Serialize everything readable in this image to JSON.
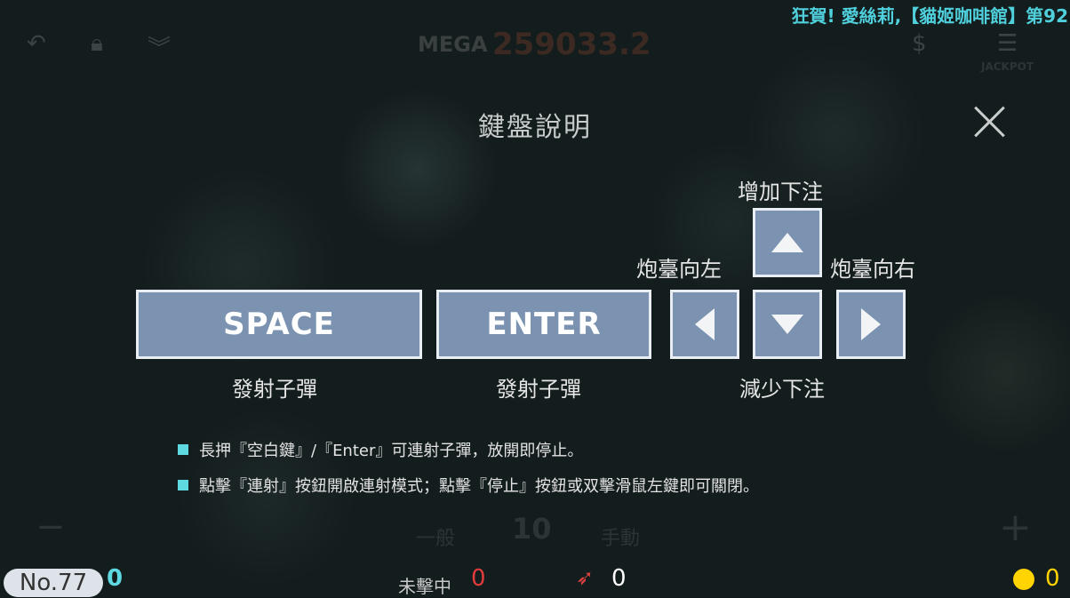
{
  "marquee": "狂賀! 愛絲莉,【貓姬咖啡館】第92",
  "hud": {
    "mega_label": "MEGA",
    "mega_value": "259033.2",
    "jackpot_label": "JACKPOT",
    "player_no": "No.77",
    "player_score": "0",
    "miss_label": "未擊中",
    "miss_count": "0",
    "rocket_count": "0",
    "coin_count": "0",
    "bet_value": "10",
    "mode_normal": "一般",
    "mode_manual": "手動"
  },
  "dialog": {
    "title": "鍵盤說明",
    "keys": {
      "space": "SPACE",
      "enter": "ENTER"
    },
    "labels": {
      "space_action": "發射子彈",
      "enter_action": "發射子彈",
      "up_action": "增加下注",
      "down_action": "減少下注",
      "left_action": "炮臺向左",
      "right_action": "炮臺向右"
    },
    "notes": [
      "長押『空白鍵』/『Enter』可連射子彈，放開即停止。",
      "點擊『連射』按鈕開啟連射模式；點擊『停止』按鈕或双擊滑鼠左鍵即可關閉。"
    ]
  },
  "colors": {
    "key_fill": "#7b93b1",
    "key_border": "#e8eef4",
    "accent": "#5ed9e2",
    "miss": "#e23b3b"
  }
}
